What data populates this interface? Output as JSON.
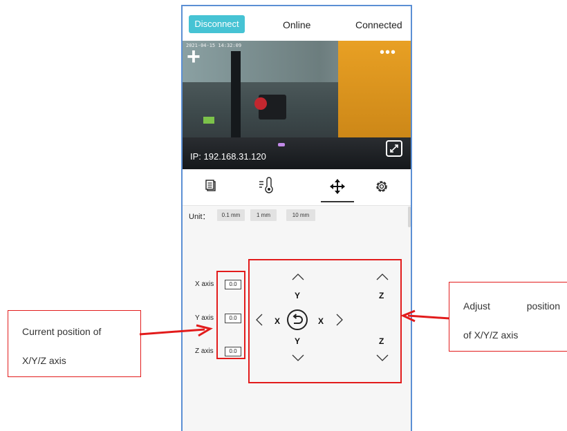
{
  "topbar": {
    "disconnect_label": "Disconnect",
    "status_online": "Online",
    "status_connected": "Connected"
  },
  "camera": {
    "timestamp": "2021-04-15 14:32:09",
    "ip": "IP: 192.168.31.120",
    "add_icon": "plus-icon",
    "more_icon": "more-dots-icon",
    "fullscreen_icon": "fullscreen-icon"
  },
  "tabs": [
    {
      "icon": "file-list-icon"
    },
    {
      "icon": "temperature-icon"
    },
    {
      "icon": "move-icon",
      "active": true
    },
    {
      "icon": "gear-icon"
    }
  ],
  "unit": {
    "label": "Unit：",
    "options": [
      "0.1 mm",
      "1 mm",
      "10 mm"
    ]
  },
  "position": {
    "x_label": "X axis",
    "x_value": "0.0",
    "y_label": "Y axis",
    "y_value": "0.0",
    "z_label": "Z axis",
    "z_value": "0.0"
  },
  "controls": {
    "y_top": "Y",
    "y_bottom": "Y",
    "x_left": "X",
    "x_right": "X",
    "z_top": "Z",
    "z_bottom": "Z",
    "home_icon": "home-reset-icon"
  },
  "annotations": {
    "left_callout_line1": "Current position of",
    "left_callout_line2": "X/Y/Z axis",
    "right_callout_line1": "Adjust position",
    "right_callout_line2": "of X/Y/Z axis",
    "highlight_color": "#e21b1b"
  },
  "colors": {
    "accent": "#46c3d4",
    "frame": "#5b8fd4"
  }
}
